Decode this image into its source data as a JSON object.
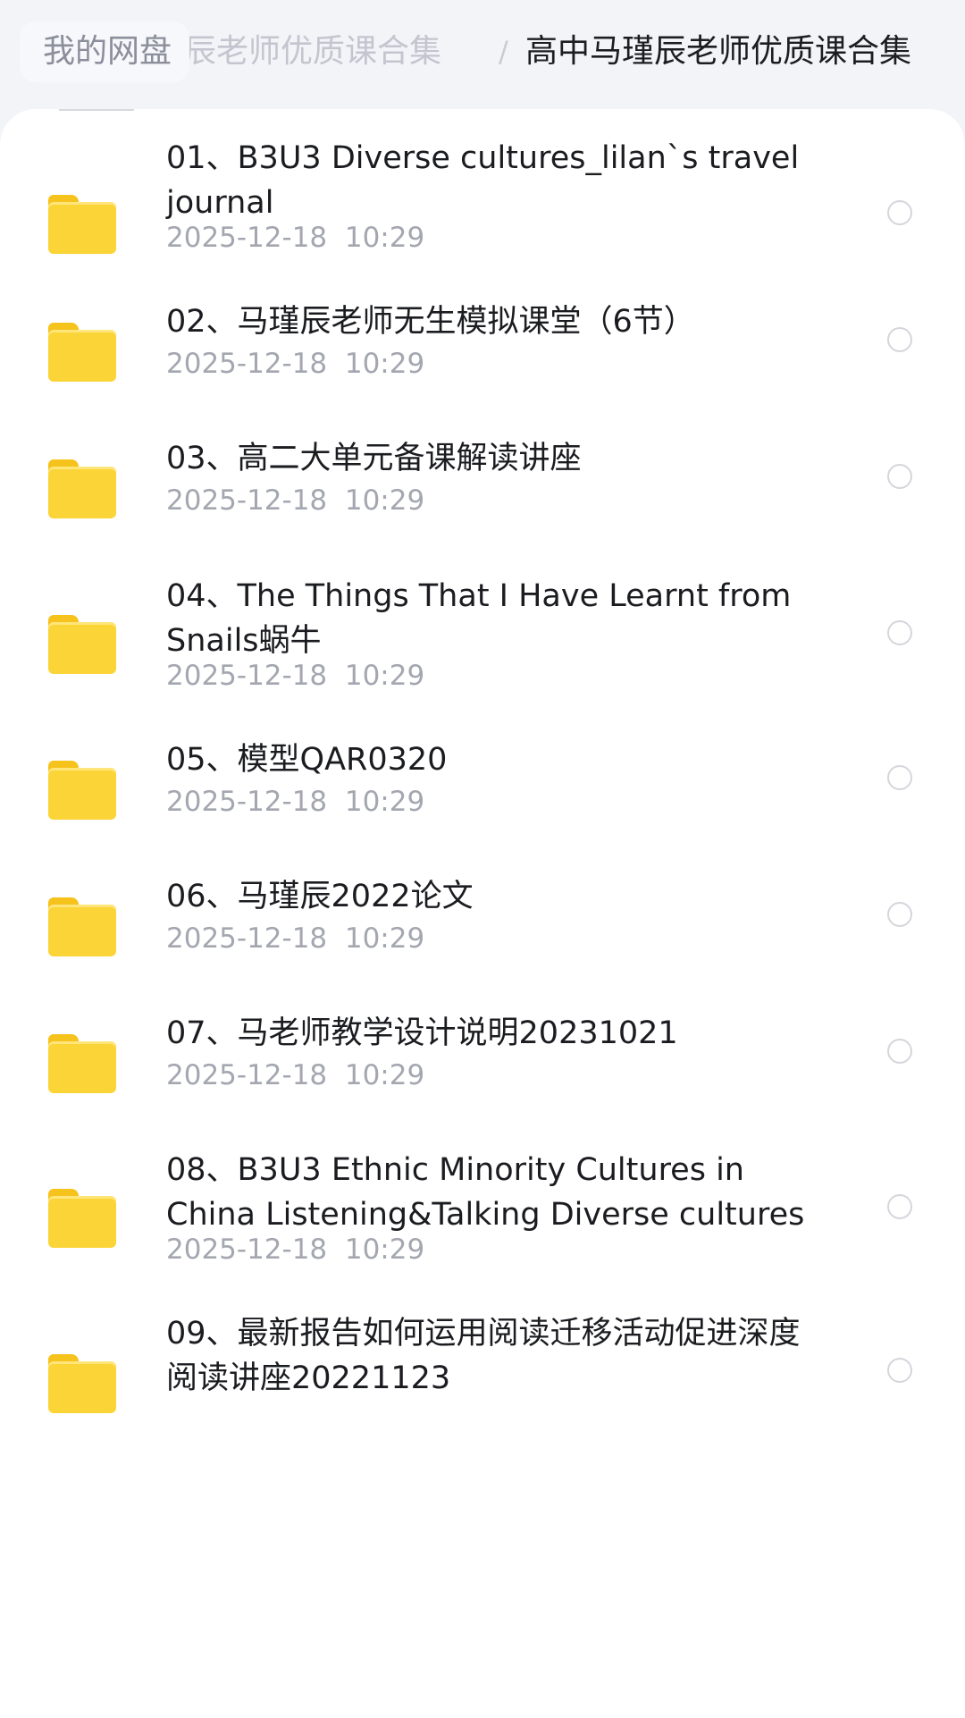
{
  "breadcrumb": {
    "root": "我的网盘",
    "previous": "瑾辰老师优质课合集",
    "separator": "/",
    "current": "高中马瑾辰老师优质课合集"
  },
  "icons": {
    "folder": "folder-icon",
    "radio": "selection-circle-icon"
  },
  "colors": {
    "folder": "#fbd437",
    "text": "#1b1c20",
    "meta": "#a4a7b0"
  },
  "files": [
    {
      "name": "01、B3U3  Diverse cultures_lilan`s travel journal",
      "date": "2025-12-18  10:29"
    },
    {
      "name": "02、马瑾辰老师无生模拟课堂（6节）",
      "date": "2025-12-18  10:29"
    },
    {
      "name": "03、高二大单元备课解读讲座",
      "date": "2025-12-18  10:29"
    },
    {
      "name": "04、The Things That I Have Learnt from Snails蜗牛",
      "date": "2025-12-18  10:29"
    },
    {
      "name": "05、模型QAR0320",
      "date": "2025-12-18  10:29"
    },
    {
      "name": "06、马瑾辰2022论文",
      "date": "2025-12-18  10:29"
    },
    {
      "name": "07、马老师教学设计说明20231021",
      "date": "2025-12-18  10:29"
    },
    {
      "name": "08、B3U3 Ethnic Minority Cultures in China Listening&Talking Diverse cultures",
      "date": "2025-12-18  10:29"
    },
    {
      "name": "09、最新报告如何运用阅读迁移活动促进深度阅读讲座20221123",
      "date": ""
    }
  ]
}
